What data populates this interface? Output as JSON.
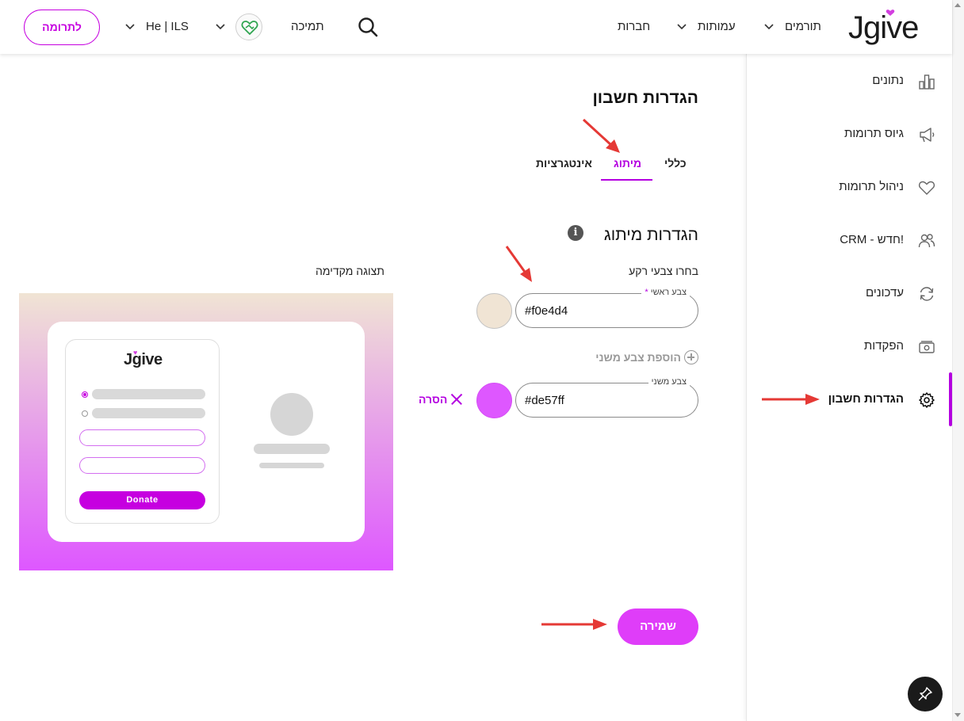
{
  "header": {
    "logo_text": "Jgive",
    "nav": {
      "donors": "תורמים",
      "nonprofits": "עמותות",
      "companies": "חברות",
      "support": "תמיכה",
      "lang_currency": "He | ILS"
    },
    "donate_label": "לתרומה"
  },
  "sidebar": {
    "items": [
      {
        "label": "נתונים",
        "icon": "bar-chart-icon"
      },
      {
        "label": "גיוס תרומות",
        "icon": "megaphone-icon"
      },
      {
        "label": "ניהול תרומות",
        "icon": "heart-icon"
      },
      {
        "label": "CRM - חדש!",
        "icon": "users-icon"
      },
      {
        "label": "עדכונים",
        "icon": "refresh-icon"
      },
      {
        "label": "הפקדות",
        "icon": "cash-icon"
      },
      {
        "label": "הגדרות חשבון",
        "icon": "gear-icon"
      }
    ],
    "active_index": 6
  },
  "main": {
    "title": "הגדרות חשבון",
    "tabs": [
      {
        "label": "כללי"
      },
      {
        "label": "מיתוג"
      },
      {
        "label": "אינטגרציות"
      }
    ],
    "active_tab": "מיתוג",
    "branding": {
      "section_title": "הגדרות מיתוג",
      "info_glyph": "i",
      "bg_colors_label": "בחרו צבעי רקע",
      "primary_label": "צבע ראשי",
      "required_mark": "*",
      "primary_value": "#f0e4d4",
      "add_secondary_label": "הוספת צבע משני",
      "secondary_label": "צבע משני",
      "secondary_value": "#de57ff",
      "remove_label": "הסרה"
    },
    "preview": {
      "label": "תצוגה מקדימה",
      "logo_text": "Jgive",
      "donate_label": "Donate"
    },
    "save_label": "שמירה"
  },
  "colors": {
    "accent": "#c600e0",
    "primary_bg": "#f0e4d4",
    "secondary_bg": "#de57ff",
    "save_button": "#df3df9",
    "annotation_arrow": "#e53935"
  }
}
